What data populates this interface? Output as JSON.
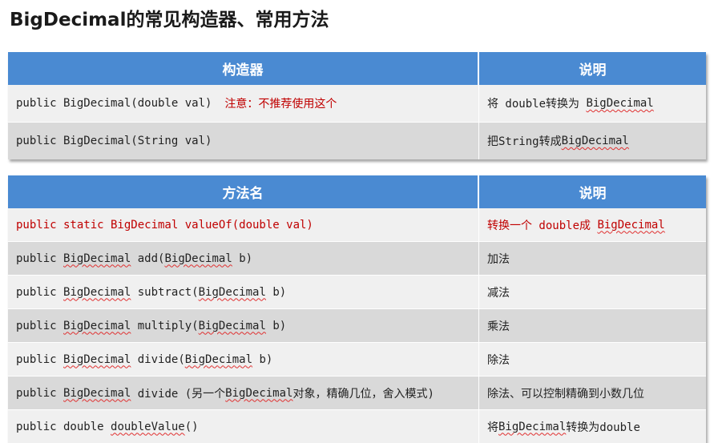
{
  "title": "BigDecimal的常见构造器、常用方法",
  "constructors": {
    "header_col1": "构造器",
    "header_col2": "说明",
    "rows": [
      {
        "sig": "public BigDecimal(double val)",
        "note": "注意：不推荐使用这个",
        "desc_pre": "将 double转换为 ",
        "desc_class": "BigDecimal"
      },
      {
        "sig": "public BigDecimal(String val)",
        "desc_pre": "把String转成",
        "desc_class": "BigDecimal"
      }
    ]
  },
  "methods": {
    "header_col1": "方法名",
    "header_col2": "说明",
    "rows": [
      {
        "sig": "public static BigDecimal valueOf(double val)",
        "desc_pre": "转换一个 double成 ",
        "desc_class": "BigDecimal"
      },
      {
        "sig_pre": "public ",
        "ret": "BigDecimal",
        "sig_mid": " add(",
        "param": "BigDecimal",
        "sig_post": " b)",
        "desc": "加法"
      },
      {
        "sig_pre": "public ",
        "ret": "BigDecimal",
        "sig_mid": " subtract(",
        "param": "BigDecimal",
        "sig_post": " b)",
        "desc": "减法"
      },
      {
        "sig_pre": "public ",
        "ret": "BigDecimal",
        "sig_mid": " multiply(",
        "param": "BigDecimal",
        "sig_post": " b)",
        "desc": "乘法"
      },
      {
        "sig_pre": "public ",
        "ret": "BigDecimal",
        "sig_mid": " divide(",
        "param": "BigDecimal",
        "sig_post": " b)",
        "desc": "除法"
      },
      {
        "sig_pre": "public ",
        "ret": "BigDecimal",
        "sig_mid": " divide (另一个",
        "param": "BigDecimal",
        "sig_post": "对象，精确几位，舍入模式)",
        "desc": "除法、可以控制精确到小数几位"
      },
      {
        "sig_pre": "public double ",
        "method": "doubleValue",
        "sig_post": "()",
        "desc_pre": "将",
        "desc_class": "BigDecimal",
        "desc_post": "转换为double"
      }
    ]
  }
}
